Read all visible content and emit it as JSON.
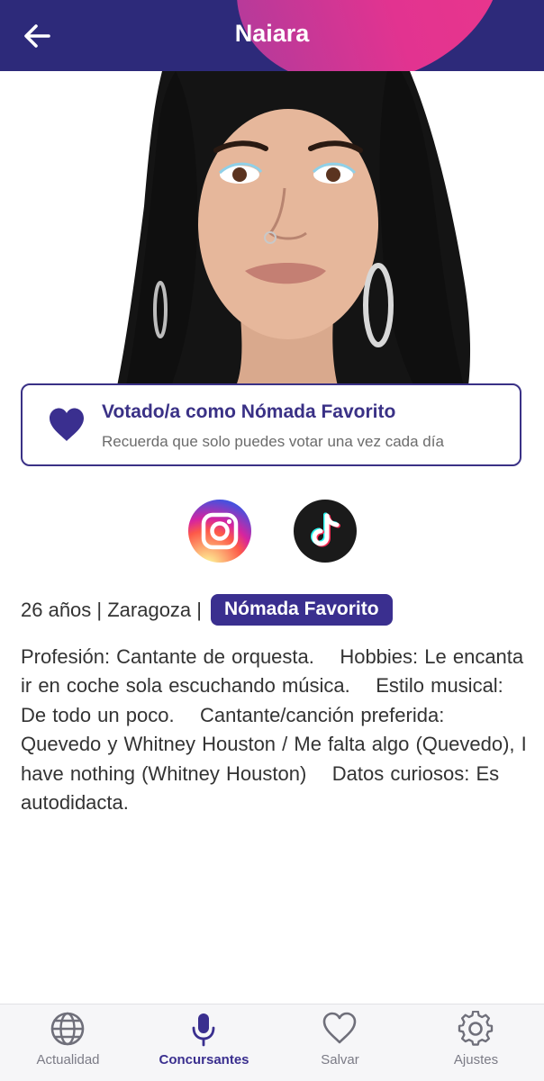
{
  "header": {
    "title": "Naiara"
  },
  "vote_card": {
    "title": "Votado/a como Nómada Favorito",
    "subtitle": "Recuerda que solo puedes votar una vez cada día"
  },
  "social": [
    {
      "name": "Instagram",
      "icon": "instagram-icon"
    },
    {
      "name": "TikTok",
      "icon": "tiktok-icon"
    }
  ],
  "profile": {
    "meta": "26 años | Zaragoza |",
    "badge": "Nómada Favorito",
    "description": "Profesión: Cantante de orquesta.    Hobbies: Le encanta ir en coche sola escuchando música.    Estilo musical: De todo un poco.    Cantante/canción preferida: Quevedo y Whitney Houston / Me falta algo (Quevedo), I have nothing (Whitney Houston)    Datos curiosos: Es autodidacta."
  },
  "bottom_nav": {
    "active": "Concursantes",
    "items": [
      {
        "label": "Actualidad",
        "icon": "globe-icon"
      },
      {
        "label": "Concursantes",
        "icon": "microphone-icon"
      },
      {
        "label": "Salvar",
        "icon": "heart-icon"
      },
      {
        "label": "Ajustes",
        "icon": "gear-icon"
      }
    ]
  },
  "colors": {
    "header_bg": "#2d2a7a",
    "accent": "#3a2f8f",
    "header_swoosh": "#e2338f"
  }
}
